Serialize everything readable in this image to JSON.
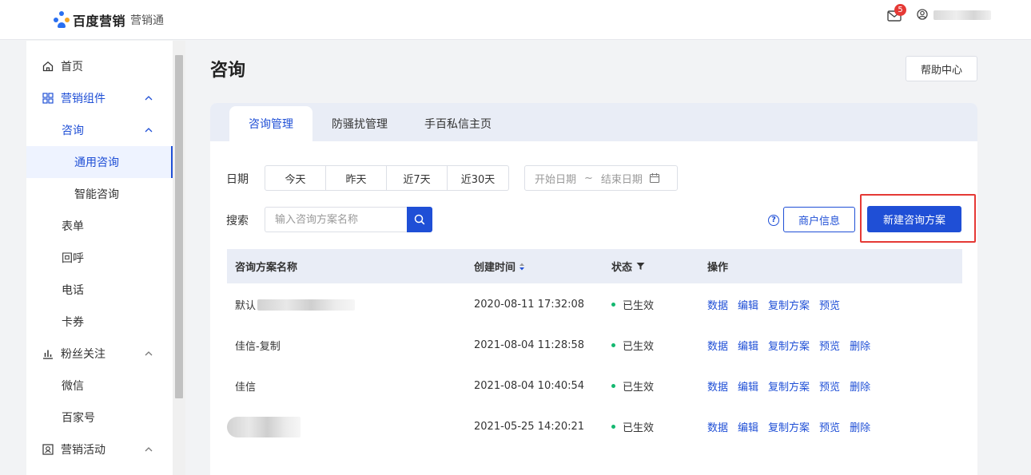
{
  "header": {
    "logo_main": "百度营销",
    "logo_sub": "营销通",
    "mail_badge": "5",
    "username": ""
  },
  "sidebar": {
    "items": [
      {
        "label": "首页"
      },
      {
        "label": "营销组件"
      },
      {
        "label": "咨询"
      },
      {
        "label": "通用咨询"
      },
      {
        "label": "智能咨询"
      },
      {
        "label": "表单"
      },
      {
        "label": "回呼"
      },
      {
        "label": "电话"
      },
      {
        "label": "卡券"
      },
      {
        "label": "粉丝关注"
      },
      {
        "label": "微信"
      },
      {
        "label": "百家号"
      },
      {
        "label": "营销活动"
      }
    ]
  },
  "main": {
    "title": "咨询",
    "help_label": "帮助中心",
    "tabs": [
      {
        "label": "咨询管理"
      },
      {
        "label": "防骚扰管理"
      },
      {
        "label": "手百私信主页"
      }
    ],
    "filter": {
      "date_label": "日期",
      "quick_dates": [
        "今天",
        "昨天",
        "近7天",
        "近30天"
      ],
      "start_placeholder": "开始日期",
      "separator": "~",
      "end_placeholder": "结束日期",
      "search_label": "搜索",
      "search_placeholder": "输入咨询方案名称",
      "merchant_label": "商户信息",
      "new_label": "新建咨询方案"
    },
    "table": {
      "columns": [
        "咨询方案名称",
        "创建时间",
        "状态",
        "操作"
      ],
      "rows": [
        {
          "name": "默认",
          "time": "2020-08-11 17:32:08",
          "status": "已生效",
          "ops": [
            "数据",
            "编辑",
            "复制方案",
            "预览"
          ]
        },
        {
          "name": "佳信-复制",
          "time": "2021-08-04 11:28:58",
          "status": "已生效",
          "ops": [
            "数据",
            "编辑",
            "复制方案",
            "预览",
            "删除"
          ]
        },
        {
          "name": "佳信",
          "time": "2021-08-04 10:40:54",
          "status": "已生效",
          "ops": [
            "数据",
            "编辑",
            "复制方案",
            "预览",
            "删除"
          ]
        },
        {
          "name": "",
          "time": "2021-05-25 14:20:21",
          "status": "已生效",
          "ops": [
            "数据",
            "编辑",
            "复制方案",
            "预览",
            "删除"
          ]
        }
      ]
    }
  },
  "colors": {
    "primary": "#1f4fd6",
    "status_green": "#14b870",
    "highlight_red": "#e53935"
  }
}
